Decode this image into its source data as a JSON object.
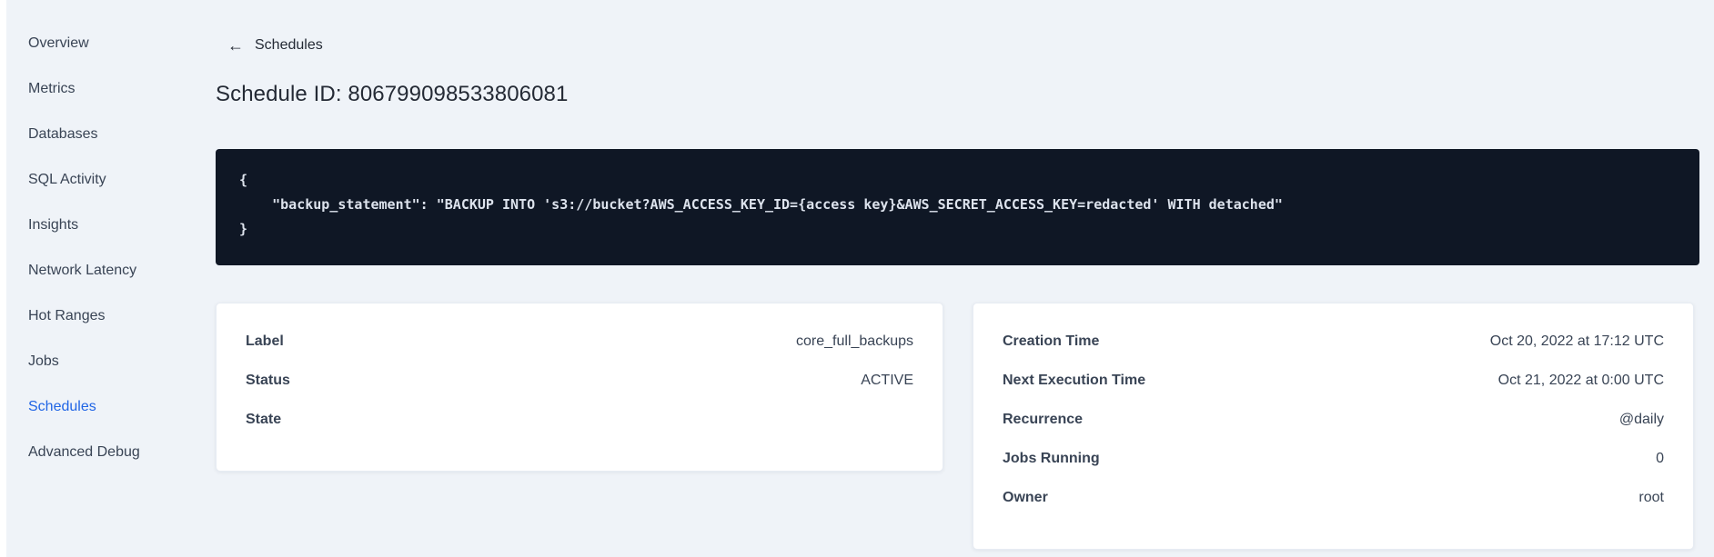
{
  "colors": {
    "page_bg": "#eff3f8",
    "card_bg": "#ffffff",
    "code_bg": "#0f1725",
    "code_text": "#dde3ed",
    "accent_blue": "#2065e5",
    "text_dark": "#242a35",
    "text_slate": "#394455"
  },
  "sidebar": {
    "items": [
      {
        "label": "Overview",
        "active": false
      },
      {
        "label": "Metrics",
        "active": false
      },
      {
        "label": "Databases",
        "active": false
      },
      {
        "label": "SQL Activity",
        "active": false
      },
      {
        "label": "Insights",
        "active": false
      },
      {
        "label": "Network Latency",
        "active": false
      },
      {
        "label": "Hot Ranges",
        "active": false
      },
      {
        "label": "Jobs",
        "active": false
      },
      {
        "label": "Schedules",
        "active": true
      },
      {
        "label": "Advanced Debug",
        "active": false
      }
    ]
  },
  "header": {
    "back_icon": "←",
    "back_label": "Schedules",
    "title": "Schedule ID: 806799098533806081"
  },
  "code_block": {
    "content": "{\n    \"backup_statement\": \"BACKUP INTO 's3://bucket?AWS_ACCESS_KEY_ID={access key}&AWS_SECRET_ACCESS_KEY=redacted' WITH detached\"\n}"
  },
  "details_card": {
    "rows": [
      {
        "label": "Label",
        "value": "core_full_backups"
      },
      {
        "label": "Status",
        "value": "ACTIVE"
      },
      {
        "label": "State",
        "value": ""
      }
    ]
  },
  "schedule_card": {
    "rows": [
      {
        "label": "Creation Time",
        "value": "Oct 20, 2022 at 17:12 UTC"
      },
      {
        "label": "Next Execution Time",
        "value": "Oct 21, 2022 at 0:00 UTC"
      },
      {
        "label": "Recurrence",
        "value": "@daily"
      },
      {
        "label": "Jobs Running",
        "value": "0"
      },
      {
        "label": "Owner",
        "value": "root"
      }
    ]
  }
}
